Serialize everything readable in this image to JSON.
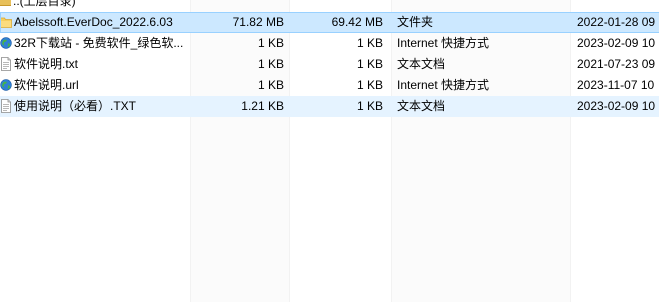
{
  "parent_row": {
    "name": "..(上层目录)"
  },
  "files": [
    {
      "name": "Abelssoft.EverDoc_2022.6.03",
      "icon": "folder-icon",
      "size": "71.82 MB",
      "packed": "69.42 MB",
      "type": "文件夹",
      "date": "2022-01-28 09",
      "state": "selected"
    },
    {
      "name": "32R下载站 - 免费软件_绿色软...",
      "icon": "internet-shortcut-icon",
      "size": "1 KB",
      "packed": "1 KB",
      "type": "Internet 快捷方式",
      "date": "2023-02-09 10",
      "state": "normal"
    },
    {
      "name": "软件说明.txt",
      "icon": "text-file-icon",
      "size": "1 KB",
      "packed": "1 KB",
      "type": "文本文档",
      "date": "2021-07-23 09",
      "state": "normal"
    },
    {
      "name": "软件说明.url",
      "icon": "internet-shortcut-icon",
      "size": "1 KB",
      "packed": "1 KB",
      "type": "Internet 快捷方式",
      "date": "2023-11-07 10",
      "state": "normal"
    },
    {
      "name": "使用说明（必看）.TXT",
      "icon": "text-file-icon",
      "size": "1.21 KB",
      "packed": "1 KB",
      "type": "文本文档",
      "date": "2023-02-09 10",
      "state": "hover"
    }
  ],
  "colors": {
    "selected_bg": "#cce8ff",
    "selected_border": "#99d1ff",
    "hover_bg": "#e5f3ff",
    "folder": "#f6cf5e"
  }
}
